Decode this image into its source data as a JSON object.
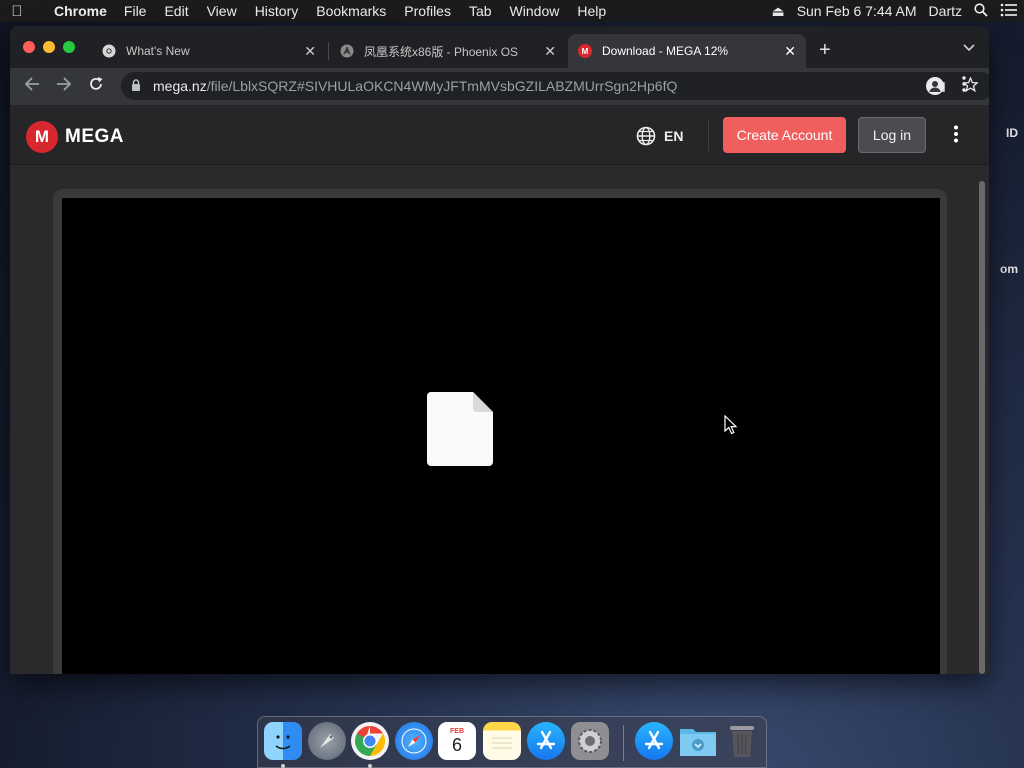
{
  "menubar": {
    "app_name": "Chrome",
    "menus": [
      "File",
      "Edit",
      "View",
      "History",
      "Bookmarks",
      "Profiles",
      "Tab",
      "Window",
      "Help"
    ],
    "clock": "Sun Feb 6  7:44 AM",
    "user": "Dartz"
  },
  "desktop": {
    "side_text_1": "ID",
    "side_text_2": "om"
  },
  "browser": {
    "tabs": [
      {
        "title": "What's New",
        "active": false
      },
      {
        "title": "凤凰系统x86版 - Phoenix OS",
        "active": false
      },
      {
        "title": "Download - MEGA 12%",
        "active": true
      }
    ],
    "url_host": "mega.nz",
    "url_path": "/file/LblxSQRZ#SIVHULaOKCN4WMyJFTmMVsbGZILABZMUrrSgn2Hp6fQ"
  },
  "mega": {
    "logo_text": "MEGA",
    "logo_mark": "M",
    "language": "EN",
    "create_account": "Create Account",
    "login": "Log in",
    "accent_color": "#f05e5e",
    "brand_red": "#d9272e"
  },
  "dock": {
    "calendar_month": "FEB",
    "calendar_day": "6",
    "apps": [
      "finder-icon",
      "launchpad-icon",
      "chrome-icon",
      "safari-icon",
      "calendar-icon",
      "notes-icon",
      "app-store-icon",
      "system-preferences-icon",
      "app-store-downloads-icon",
      "downloads-folder-icon",
      "trash-icon"
    ]
  }
}
